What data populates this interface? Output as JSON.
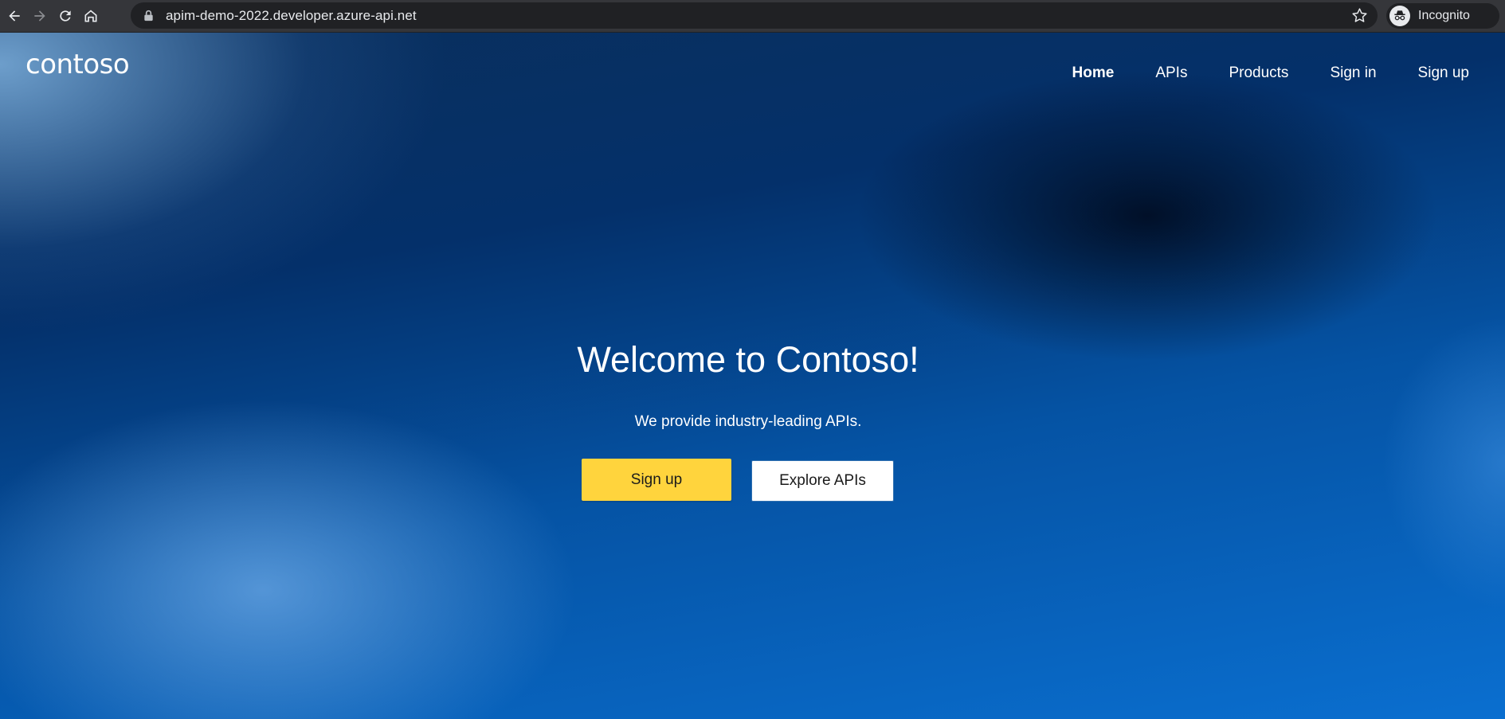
{
  "browser": {
    "url": "apim-demo-2022.developer.azure-api.net",
    "profile_label": "Incognito",
    "icons": {
      "back": "arrow-left-icon",
      "forward": "arrow-right-icon",
      "reload": "reload-icon",
      "home": "home-icon",
      "lock": "lock-icon",
      "bookmark": "star-icon",
      "profile": "incognito-icon"
    }
  },
  "site": {
    "logo": "contoso",
    "nav": [
      {
        "label": "Home",
        "active": true
      },
      {
        "label": "APIs",
        "active": false
      },
      {
        "label": "Products",
        "active": false
      },
      {
        "label": "Sign in",
        "active": false
      },
      {
        "label": "Sign up",
        "active": false
      }
    ]
  },
  "hero": {
    "title": "Welcome to Contoso!",
    "subtitle": "We provide industry-leading APIs.",
    "primary_button": "Sign up",
    "secondary_button": "Explore APIs"
  },
  "colors": {
    "primary_button_bg": "#ffd43d",
    "secondary_button_bg": "#ffffff",
    "chrome_bg": "#35363a",
    "omnibox_bg": "#202124"
  }
}
